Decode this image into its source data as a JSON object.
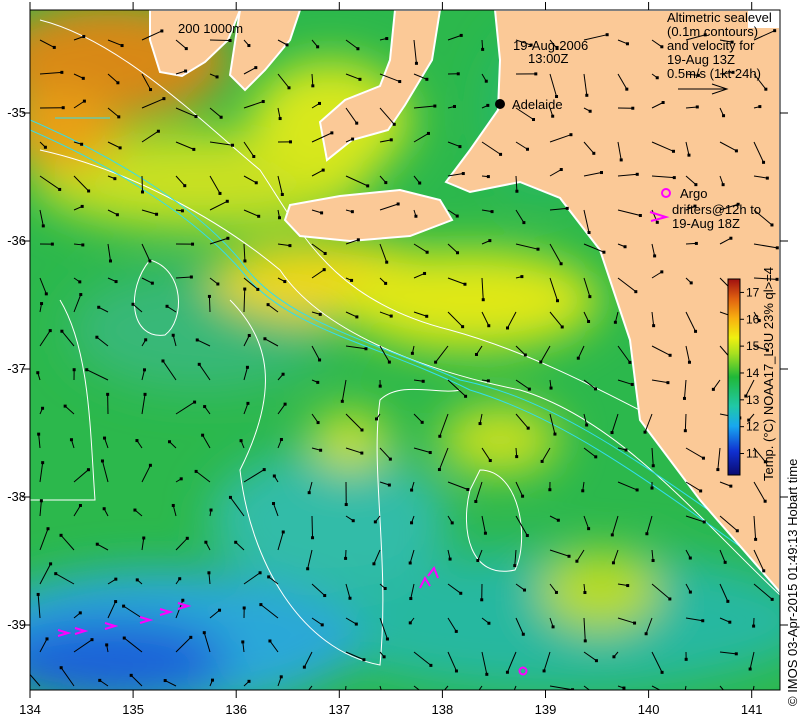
{
  "map": {
    "date": "19-Aug-2006",
    "time": "13:00Z",
    "city": "Adelaide",
    "scale_label": "200  1000m",
    "legend_lines": [
      "Altimetric sealevel",
      "(0.1m contours)",
      "and velocity for",
      "19-Aug 13Z",
      "0.5m/s (1kt 24h)"
    ],
    "argo_label": "Argo",
    "drifters_lines": [
      "drifters@12h to",
      "19-Aug 18Z"
    ],
    "x_ticks": [
      "134",
      "135",
      "136",
      "137",
      "138",
      "139",
      "140",
      "141"
    ],
    "y_ticks": [
      "-35",
      "-36",
      "-37",
      "-38",
      "-39"
    ],
    "colorbar": {
      "ticks": [
        "11",
        "12",
        "13",
        "14",
        "15",
        "16",
        "17"
      ],
      "label": "Temp. (°C) NOAA17_L3U 23% ql>=4",
      "range": [
        10.2,
        17.5
      ]
    },
    "credit": "© IMOS 03-Apr-2015 01:49:13 Hobart time",
    "colors": {
      "land": "#fbc997",
      "argo": "#ff00ff",
      "contour": "#ffffff",
      "isobath": "#33ddee"
    }
  }
}
